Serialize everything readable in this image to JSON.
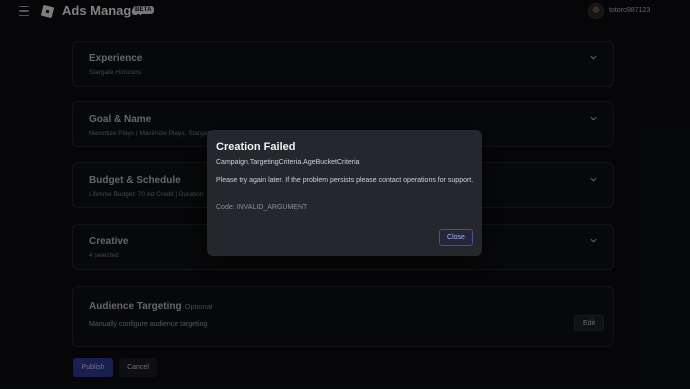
{
  "header": {
    "app_title": "Ads Manager",
    "beta_badge": "BETA",
    "username": "totoro987123",
    "icons": {
      "menu": "hamburger-menu-icon",
      "logo": "roblox-logo-icon",
      "avatar": "user-avatar"
    }
  },
  "sections": [
    {
      "title": "Experience",
      "subtitle": "Stargate Horizons",
      "icon": "chevron-down-icon"
    },
    {
      "title": "Goal & Name",
      "subtitle": "Maximize Plays | Maximize Plays, Stargate Horizons, 09/23/2025 10:10",
      "icon": "chevron-down-icon"
    },
    {
      "title": "Budget & Schedule",
      "subtitle": "Lifetime Budget: 70 Ad Credit | Duration",
      "icon": "chevron-down-icon"
    },
    {
      "title": "Creative",
      "subtitle": "4 selected",
      "icon": "chevron-down-icon"
    }
  ],
  "audience": {
    "title": "Audience Targeting",
    "optional_label": "Optional",
    "description": "Manually configure audience targeting",
    "edit_label": "Edit"
  },
  "footer": {
    "publish_label": "Publish",
    "cancel_label": "Cancel"
  },
  "modal": {
    "title": "Creation Failed",
    "subtitle": "Campaign.TargetingCriteria.AgeBucketCriteria",
    "message": "Please try again later. If the problem persists please contact operations for support.",
    "code": "Code: INVALID_ARGUMENT",
    "close_label": "Close"
  },
  "colors": {
    "accent": "#2f3a8f",
    "modal_bg": "#26272c",
    "page_bg": "#0b0c0f"
  }
}
